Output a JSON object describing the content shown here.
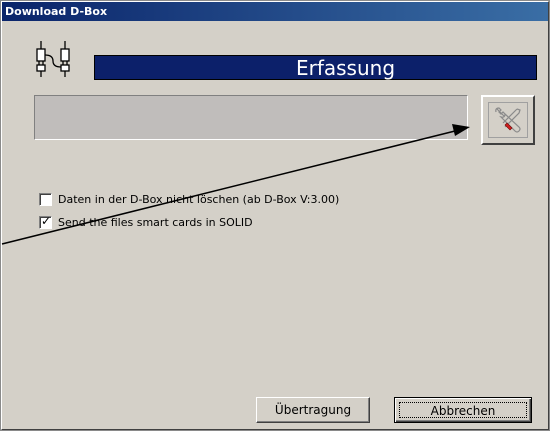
{
  "window": {
    "title": "Download D-Box"
  },
  "header": {
    "banner_text": "Erfassung",
    "icon": "connector-plugs-icon"
  },
  "status": {
    "value": ""
  },
  "tools_button": {
    "icon": "tools-wrench-screwdriver-icon"
  },
  "options": [
    {
      "label": "Daten in der D-Box nicht löschen (ab D-Box V:3.00)",
      "checked": false
    },
    {
      "label": "Send the files smart cards in SOLID",
      "checked": true
    }
  ],
  "buttons": {
    "transfer_label": "Übertragung",
    "cancel_label": "Abbrechen"
  },
  "colors": {
    "title_bar": "#0a246a",
    "banner": "#0c206a",
    "window_bg": "#d4d0c8",
    "status_field": "#c0bdbb"
  }
}
